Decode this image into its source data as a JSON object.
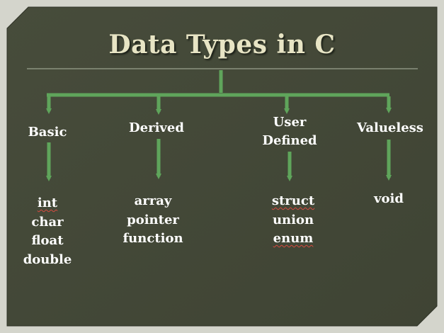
{
  "title": "Data Types in C",
  "categories": [
    {
      "label": "Basic",
      "items": [
        "int",
        "char",
        "float",
        "double"
      ]
    },
    {
      "label": "Derived",
      "items": [
        "array",
        "pointer",
        "function"
      ]
    },
    {
      "label_lines": [
        "User",
        "Defined"
      ],
      "items": [
        "struct",
        "union",
        "enum"
      ]
    },
    {
      "label": "Valueless",
      "items": [
        "void"
      ]
    }
  ],
  "colors": {
    "background": "#434837",
    "connector": "#5fa55b",
    "title_text": "#e7e4c4",
    "text": "#ffffff",
    "page": "#d4d5cc"
  }
}
